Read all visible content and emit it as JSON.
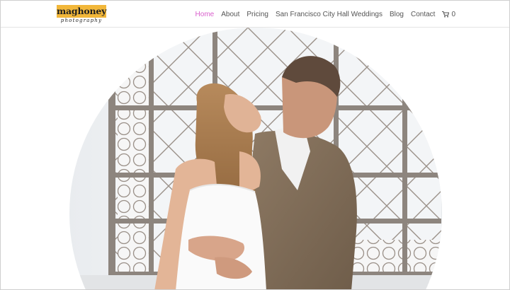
{
  "logo": {
    "title": "maghoney",
    "subtitle": "photography",
    "accent_color": "#f2b73a"
  },
  "nav": {
    "items": [
      {
        "label": "Home",
        "active": true
      },
      {
        "label": "About",
        "active": false
      },
      {
        "label": "Pricing",
        "active": false
      },
      {
        "label": "San Francisco City Hall Weddings",
        "active": false
      },
      {
        "label": "Blog",
        "active": false
      },
      {
        "label": "Contact",
        "active": false
      }
    ],
    "cart_icon": "shopping-cart-icon",
    "cart_count": "0",
    "active_color": "#d95ecc"
  },
  "hero": {
    "image": "couple-kissing-in-front-of-window-photo",
    "shape": "circle"
  }
}
